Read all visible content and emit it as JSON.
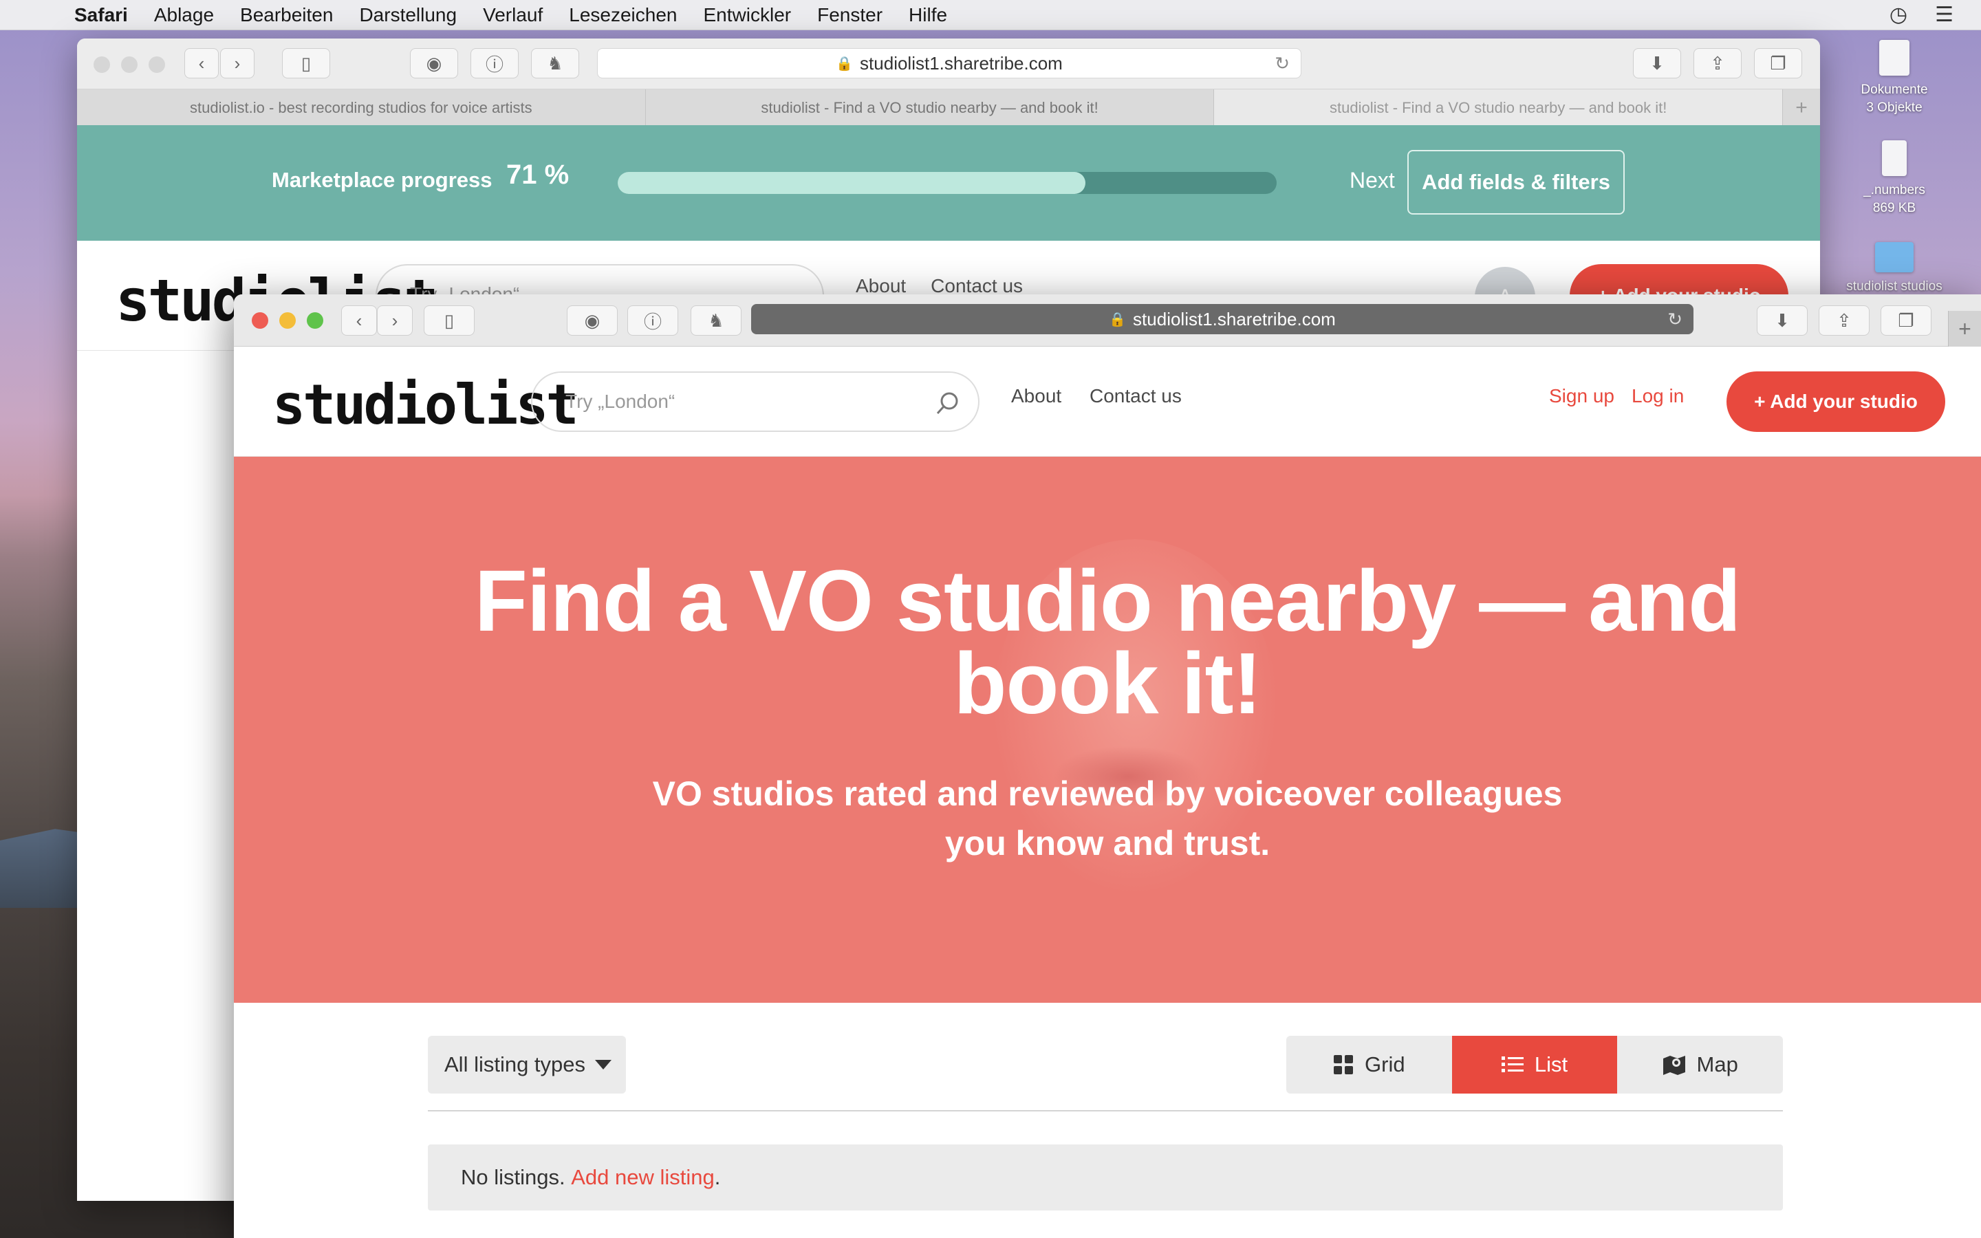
{
  "menubar": {
    "app": "Safari",
    "items": [
      "Ablage",
      "Bearbeiten",
      "Darstellung",
      "Verlauf",
      "Lesezeichen",
      "Entwickler",
      "Fenster",
      "Hilfe"
    ]
  },
  "desktop": {
    "icons": [
      {
        "label": "Dokumente",
        "sub": "3 Objekte"
      },
      {
        "label": "_.numbers",
        "sub": "869 KB"
      },
      {
        "label": "studiolist studios",
        "sub": ""
      }
    ]
  },
  "back_window": {
    "url": "studiolist1.sharetribe.com",
    "tabs": [
      "studiolist.io - best recording studios for voice artists",
      "studiolist - Find a VO studio nearby — and book it!",
      "studiolist - Find a VO studio nearby — and book it!"
    ],
    "active_tab": 2,
    "progress": {
      "label": "Marketplace progress",
      "percent_text": "71 %",
      "percent": 71,
      "next_label": "Next",
      "button_label": "Add fields & filters"
    },
    "header": {
      "logo": "studiolist",
      "search_placeholder": "Try „London“",
      "nav": [
        "About",
        "Contact us"
      ],
      "avatar_letter": "A",
      "add_button": "+ Add your studio"
    }
  },
  "front_window": {
    "url": "studiolist1.sharetribe.com",
    "header": {
      "logo": "studiolist",
      "search_placeholder": "Try „London“",
      "nav": [
        "About",
        "Contact us"
      ],
      "sign_up": "Sign up",
      "log_in": "Log in",
      "add_button": "+ Add your studio"
    },
    "hero": {
      "title": "Find a VO studio nearby — and book it!",
      "subtitle": "VO studios rated and reviewed by voiceover colleagues you know and trust."
    },
    "filters": {
      "listing_type": "All listing types",
      "views": [
        "Grid",
        "List",
        "Map"
      ],
      "active_view": "List",
      "empty_text": "No listings.",
      "empty_link": "Add new listing",
      "empty_suffix": "."
    }
  },
  "colors": {
    "brand": "#e8493e",
    "hero_bg": "#ec7a72",
    "progress_bg": "#6fb2a7"
  }
}
